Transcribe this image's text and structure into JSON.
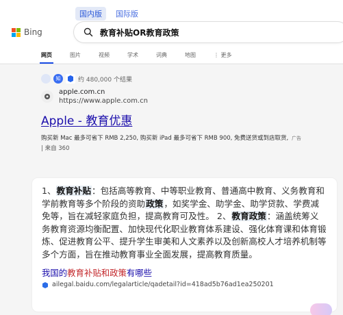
{
  "region_tabs": [
    {
      "label": "国内版",
      "active": true
    },
    {
      "label": "国际版",
      "active": false
    }
  ],
  "brand": {
    "name": "Bing",
    "colors": [
      "#f25022",
      "#7fba00",
      "#00a4ef",
      "#ffb900"
    ]
  },
  "search": {
    "query": "教育补贴OR教育政策"
  },
  "nav": [
    {
      "label": "网页",
      "active": true
    },
    {
      "label": "图片"
    },
    {
      "label": "视频"
    },
    {
      "label": "学术"
    },
    {
      "label": "词典"
    },
    {
      "label": "地图"
    },
    {
      "label": "更多",
      "icon": "more-vertical-icon"
    }
  ],
  "results": {
    "count_text": "约 480,000 个结果",
    "chip_label": "知"
  },
  "ad": {
    "domain": "apple.com.cn",
    "url": "https://www.apple.com.cn",
    "title": "Apple - 教育优惠",
    "description": "购买新 Mac 最多可省下 RMB 2,250, 购买新 iPad 最多可省下 RMB 900, 免费送货或到店取货,",
    "tag": "广告",
    "source": "| 来自 360"
  },
  "answer": {
    "p1": "1、",
    "h1": "教育补贴",
    "p2": "：包括高等教育、中等职业教育、普通高中教育、义务教育和学前教育等多个阶段的资助",
    "h2": "政策",
    "p3": "，如奖学金、助学金、助学贷款、学费减免等，旨在减轻家庭负担，提高教育可及性。 2、",
    "h3": "教育政策",
    "p4": "：涵盖统筹义务教育资源均衡配置、加快现代化职业教育体系建设、强化体育课和体育锻炼、促进教育公平、提升学生审美和人文素养以及创新高校人才培养机制等多个方面，旨在推动教育事业全面发展，提高教育质量。",
    "link_prefix": "我国的",
    "link_red": "教育补贴和政策",
    "link_suffix": "有哪些",
    "source_url": "ailegal.baidu.com/legalarticle/qadetail?id=418ad5b76ad1ea250201"
  },
  "colors": {
    "link": "#1a0dab",
    "accent": "#174ae4",
    "highlight_bg": "#e8eef4"
  }
}
